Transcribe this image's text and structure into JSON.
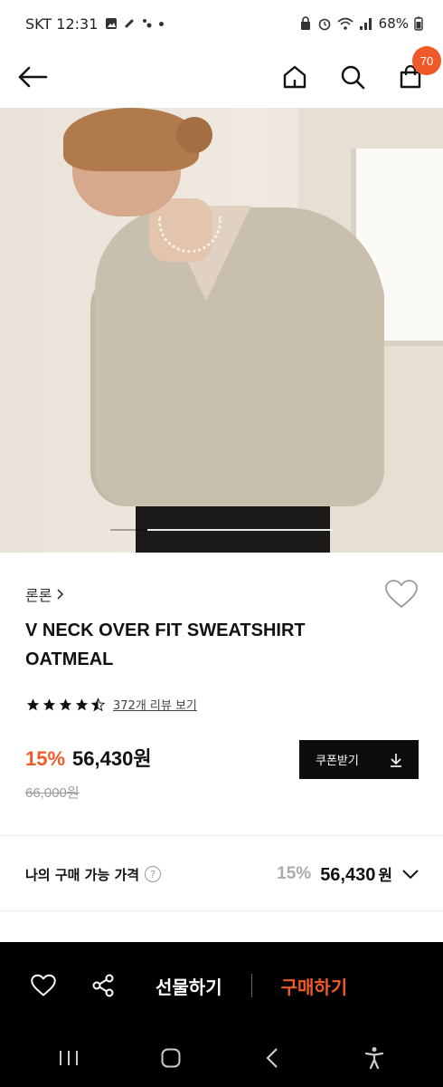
{
  "status_bar": {
    "carrier_time": "SKT 12:31",
    "battery": "68%"
  },
  "header": {
    "cart_count": "70",
    "icons": [
      "back-arrow-icon",
      "home-icon",
      "search-icon",
      "shopping-bag-icon"
    ]
  },
  "gallery": {
    "current_slide_fraction": 0.83
  },
  "product": {
    "brand": "론론",
    "name": "V NECK OVER FIT SWEATSHIRT OATMEAL",
    "rating_stars": 4.5,
    "review_link": "372개 리뷰 보기",
    "discount": "15%",
    "price": "56,430원",
    "original_price": "66,000원",
    "coupon_button": "쿠폰받기"
  },
  "my_price": {
    "label": "나의 구매 가능 가격",
    "discount": "15%",
    "value": "56,430",
    "unit": "원"
  },
  "bottom_bar": {
    "gift": "선물하기",
    "buy": "구매하기"
  },
  "colors": {
    "accent": "#f05a28",
    "dark": "#0d0d0d"
  }
}
